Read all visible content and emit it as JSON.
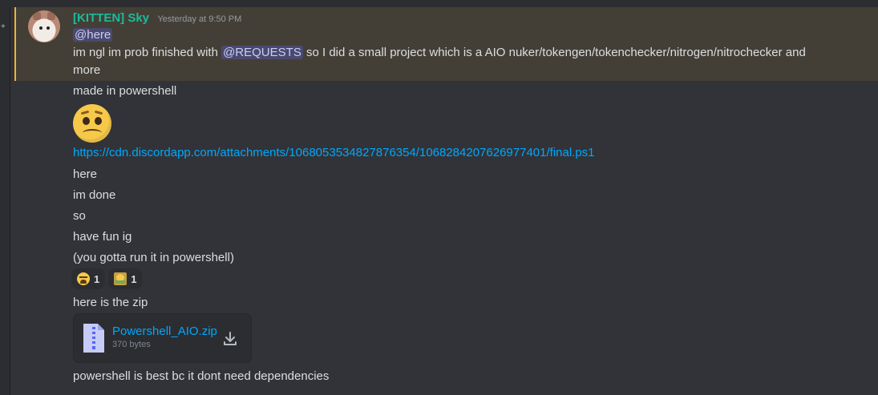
{
  "message": {
    "username": "[KITTEN] Sky",
    "timestamp": "Yesterday at 9:50 PM",
    "mention_here": "@here",
    "line1_prefix": "im ngl im prob finished with ",
    "mention_role": "@REQUESTS",
    "line1_suffix": " so I did a small project which is a AIO nuker/tokengen/tokenchecker/nitrogen/nitrochecker and",
    "line1_wrap": "more"
  },
  "followups": {
    "made_in": "made in powershell",
    "emoji": "woozy-face",
    "link": "https://cdn.discordapp.com/attachments/1068053534827876354/1068284207626977401/final.ps1",
    "here": "here",
    "im_done": "im done",
    "so": "so",
    "have_fun": "have fun ig",
    "run_it": "(you gotta run it in powershell)",
    "here_zip": "here is the zip",
    "powershell_best": "powershell is best bc it dont need dependencies"
  },
  "reactions": [
    {
      "emoji": "weary-face",
      "count": "1"
    },
    {
      "emoji": "money-mouth-face",
      "count": "1"
    }
  ],
  "attachment": {
    "name": "Powershell_AIO.zip",
    "size": "370 bytes",
    "icon": "zip-file-icon",
    "action_icon": "download-icon"
  },
  "colors": {
    "background": "#313338",
    "highlight": "#443f36",
    "highlight_bar": "#f0b232",
    "username": "#1abc9c",
    "link": "#00a8fc"
  }
}
